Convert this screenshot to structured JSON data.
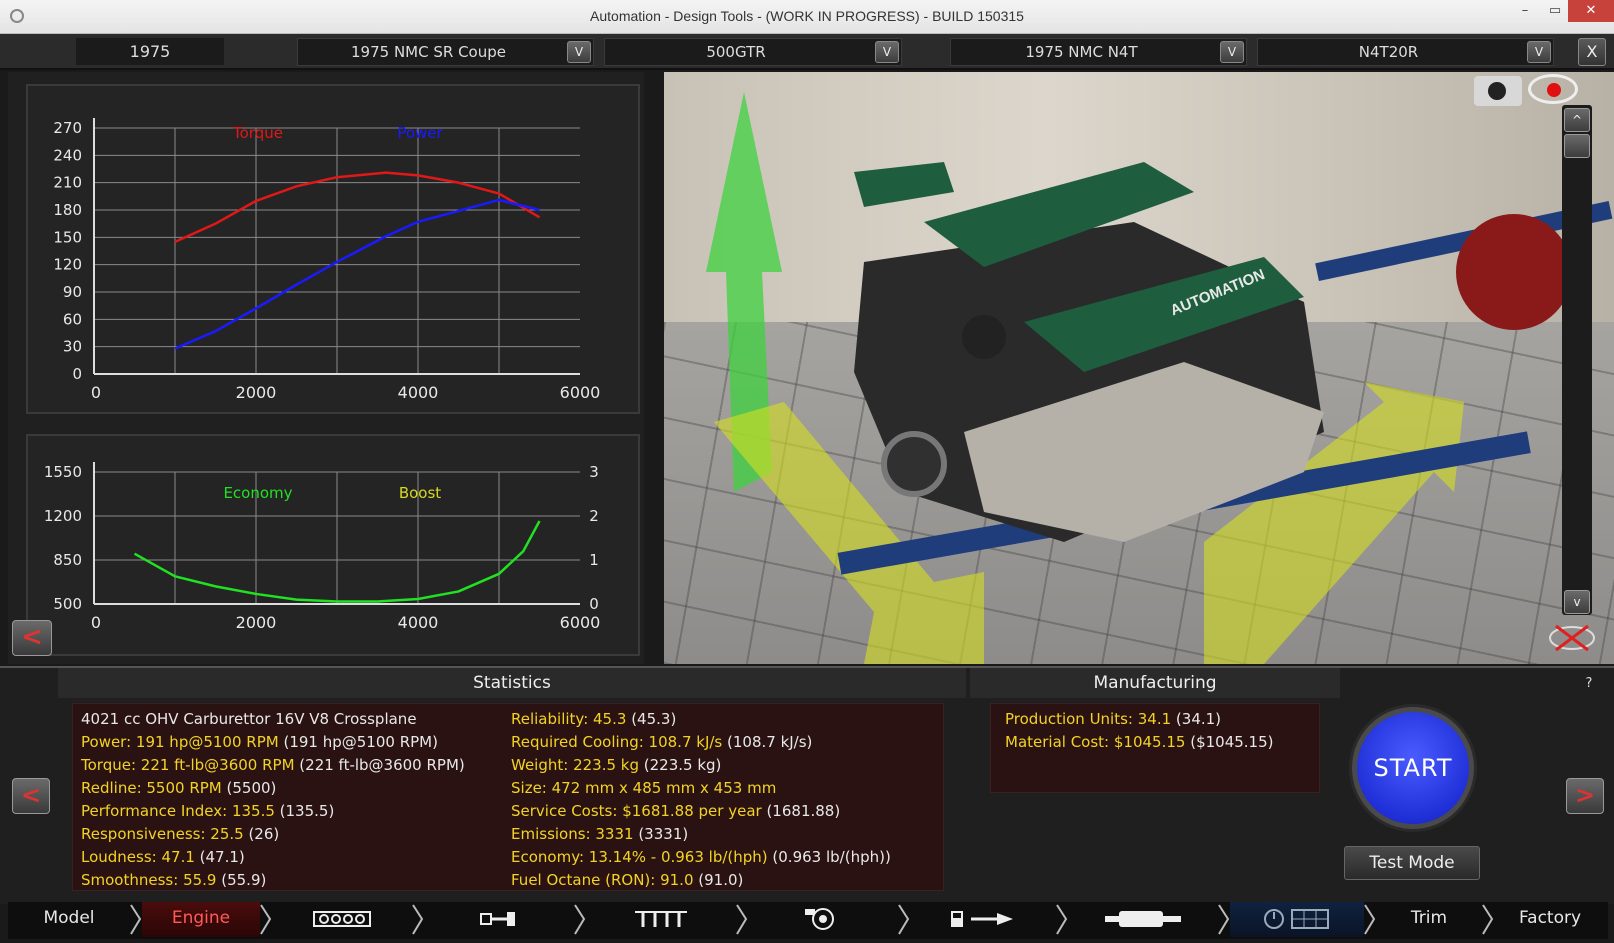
{
  "window": {
    "title": "Automation - Design Tools - (WORK IN PROGRESS) - BUILD 150315",
    "minimize": "–",
    "maximize": "▭",
    "close": "✕"
  },
  "topbar": {
    "year": "1975",
    "model": "1975 NMC SR Coupe",
    "trim": "500GTR",
    "engine_family": "1975 NMC N4T",
    "engine_variant": "N4T20R",
    "dropdown_glyph": "V",
    "close_glyph": "X"
  },
  "power_chart": {
    "legend_torque": "Torque",
    "legend_power": "Power",
    "y_ticks": [
      "270",
      "240",
      "210",
      "180",
      "150",
      "120",
      "90",
      "60",
      "30",
      "0"
    ],
    "x_ticks": [
      "0",
      "2000",
      "4000",
      "6000"
    ],
    "torque_color": "#e01818",
    "power_color": "#1a1aff"
  },
  "economy_chart": {
    "legend_economy": "Economy",
    "legend_boost": "Boost",
    "y_left_ticks": [
      "1550",
      "1200",
      "850",
      "500"
    ],
    "y_right_ticks": [
      "3",
      "2",
      "1",
      "0"
    ],
    "x_ticks": [
      "0",
      "2000",
      "4000",
      "6000"
    ],
    "economy_color": "#22e022",
    "boost_color": "#d8d820"
  },
  "chart_data": [
    {
      "type": "line",
      "x": [
        1000,
        1500,
        2000,
        2500,
        3000,
        3600,
        4000,
        4500,
        5000,
        5500
      ],
      "series": [
        {
          "name": "Torque",
          "values": [
            145,
            165,
            190,
            206,
            216,
            221,
            218,
            210,
            198,
            172
          ]
        },
        {
          "name": "Power",
          "values": [
            28,
            47,
            72,
            98,
            123,
            151,
            167,
            179,
            191,
            180
          ]
        }
      ],
      "xlim": [
        0,
        6000
      ],
      "ylim": [
        0,
        270
      ],
      "grid": true
    },
    {
      "type": "line",
      "x": [
        500,
        1000,
        1500,
        2000,
        2500,
        3000,
        3500,
        4000,
        4500,
        5000,
        5300,
        5500
      ],
      "series": [
        {
          "name": "Economy",
          "values": [
            900,
            720,
            640,
            580,
            535,
            520,
            520,
            540,
            600,
            740,
            920,
            1160
          ]
        }
      ],
      "xlim": [
        0,
        6000
      ],
      "ylim": [
        500,
        1550
      ],
      "y2lim": [
        0,
        3
      ],
      "grid": true
    }
  ],
  "statistics": {
    "header": "Statistics",
    "left": [
      {
        "key": "",
        "value": "4021 cc OHV Carburettor 16V V8 Crossplane"
      },
      {
        "key": "Power: 191 hp@5100 RPM",
        "value": " (191 hp@5100 RPM)"
      },
      {
        "key": "Torque: 221 ft-lb@3600 RPM",
        "value": " (221 ft-lb@3600 RPM)"
      },
      {
        "key": "Redline: 5500 RPM",
        "value": " (5500)"
      },
      {
        "key": "Performance Index: 135.5",
        "value": " (135.5)"
      },
      {
        "key": "Responsiveness: 25.5",
        "value": " (26)"
      },
      {
        "key": "Loudness: 47.1",
        "value": " (47.1)"
      },
      {
        "key": "Smoothness: 55.9",
        "value": " (55.9)"
      }
    ],
    "right": [
      {
        "key": "Reliability: 45.3",
        "value": " (45.3)"
      },
      {
        "key": "Required Cooling: 108.7 kJ/s",
        "value": " (108.7 kJ/s)"
      },
      {
        "key": "Weight: 223.5 kg",
        "value": " (223.5 kg)"
      },
      {
        "key": "Size: 472 mm x 485 mm x 453 mm",
        "value": ""
      },
      {
        "key": "Service Costs: $1681.88 per year",
        "value": " (1681.88)"
      },
      {
        "key": "Emissions: 3331",
        "value": " (3331)"
      },
      {
        "key": "Economy: 13.14% - 0.963 lb/(hph)",
        "value": " (0.963 lb/(hph))"
      },
      {
        "key": "Fuel Octane (RON): 91.0",
        "value": " (91.0)"
      }
    ]
  },
  "manufacturing": {
    "header": "Manufacturing",
    "rows": [
      {
        "key": "Production Units: 34.1",
        "value": " (34.1)"
      },
      {
        "key": "Material Cost: $1045.15",
        "value": " ($1045.15)"
      }
    ]
  },
  "actions": {
    "start": "START",
    "test_mode": "Test Mode",
    "help": "?",
    "prev": "<",
    "next": ">",
    "back": "<"
  },
  "viewport": {
    "brand": "AUTOMATION",
    "scroll_up": "^",
    "scroll_down": "v"
  },
  "navbar": {
    "tabs": [
      "Model",
      "Engine",
      "Trim",
      "Factory"
    ]
  }
}
